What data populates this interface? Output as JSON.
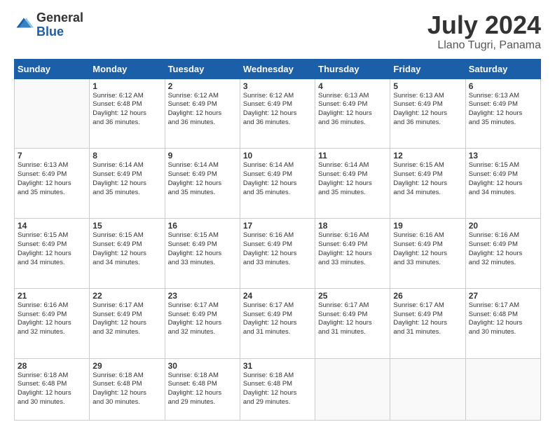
{
  "logo": {
    "general": "General",
    "blue": "Blue"
  },
  "title": "July 2024",
  "subtitle": "Llano Tugri, Panama",
  "days_header": [
    "Sunday",
    "Monday",
    "Tuesday",
    "Wednesday",
    "Thursday",
    "Friday",
    "Saturday"
  ],
  "weeks": [
    [
      {
        "date": "",
        "info": ""
      },
      {
        "date": "1",
        "info": "Sunrise: 6:12 AM\nSunset: 6:48 PM\nDaylight: 12 hours\nand 36 minutes."
      },
      {
        "date": "2",
        "info": "Sunrise: 6:12 AM\nSunset: 6:49 PM\nDaylight: 12 hours\nand 36 minutes."
      },
      {
        "date": "3",
        "info": "Sunrise: 6:12 AM\nSunset: 6:49 PM\nDaylight: 12 hours\nand 36 minutes."
      },
      {
        "date": "4",
        "info": "Sunrise: 6:13 AM\nSunset: 6:49 PM\nDaylight: 12 hours\nand 36 minutes."
      },
      {
        "date": "5",
        "info": "Sunrise: 6:13 AM\nSunset: 6:49 PM\nDaylight: 12 hours\nand 36 minutes."
      },
      {
        "date": "6",
        "info": "Sunrise: 6:13 AM\nSunset: 6:49 PM\nDaylight: 12 hours\nand 35 minutes."
      }
    ],
    [
      {
        "date": "7",
        "info": "Sunrise: 6:13 AM\nSunset: 6:49 PM\nDaylight: 12 hours\nand 35 minutes."
      },
      {
        "date": "8",
        "info": "Sunrise: 6:14 AM\nSunset: 6:49 PM\nDaylight: 12 hours\nand 35 minutes."
      },
      {
        "date": "9",
        "info": "Sunrise: 6:14 AM\nSunset: 6:49 PM\nDaylight: 12 hours\nand 35 minutes."
      },
      {
        "date": "10",
        "info": "Sunrise: 6:14 AM\nSunset: 6:49 PM\nDaylight: 12 hours\nand 35 minutes."
      },
      {
        "date": "11",
        "info": "Sunrise: 6:14 AM\nSunset: 6:49 PM\nDaylight: 12 hours\nand 35 minutes."
      },
      {
        "date": "12",
        "info": "Sunrise: 6:15 AM\nSunset: 6:49 PM\nDaylight: 12 hours\nand 34 minutes."
      },
      {
        "date": "13",
        "info": "Sunrise: 6:15 AM\nSunset: 6:49 PM\nDaylight: 12 hours\nand 34 minutes."
      }
    ],
    [
      {
        "date": "14",
        "info": "Sunrise: 6:15 AM\nSunset: 6:49 PM\nDaylight: 12 hours\nand 34 minutes."
      },
      {
        "date": "15",
        "info": "Sunrise: 6:15 AM\nSunset: 6:49 PM\nDaylight: 12 hours\nand 34 minutes."
      },
      {
        "date": "16",
        "info": "Sunrise: 6:15 AM\nSunset: 6:49 PM\nDaylight: 12 hours\nand 33 minutes."
      },
      {
        "date": "17",
        "info": "Sunrise: 6:16 AM\nSunset: 6:49 PM\nDaylight: 12 hours\nand 33 minutes."
      },
      {
        "date": "18",
        "info": "Sunrise: 6:16 AM\nSunset: 6:49 PM\nDaylight: 12 hours\nand 33 minutes."
      },
      {
        "date": "19",
        "info": "Sunrise: 6:16 AM\nSunset: 6:49 PM\nDaylight: 12 hours\nand 33 minutes."
      },
      {
        "date": "20",
        "info": "Sunrise: 6:16 AM\nSunset: 6:49 PM\nDaylight: 12 hours\nand 32 minutes."
      }
    ],
    [
      {
        "date": "21",
        "info": "Sunrise: 6:16 AM\nSunset: 6:49 PM\nDaylight: 12 hours\nand 32 minutes."
      },
      {
        "date": "22",
        "info": "Sunrise: 6:17 AM\nSunset: 6:49 PM\nDaylight: 12 hours\nand 32 minutes."
      },
      {
        "date": "23",
        "info": "Sunrise: 6:17 AM\nSunset: 6:49 PM\nDaylight: 12 hours\nand 32 minutes."
      },
      {
        "date": "24",
        "info": "Sunrise: 6:17 AM\nSunset: 6:49 PM\nDaylight: 12 hours\nand 31 minutes."
      },
      {
        "date": "25",
        "info": "Sunrise: 6:17 AM\nSunset: 6:49 PM\nDaylight: 12 hours\nand 31 minutes."
      },
      {
        "date": "26",
        "info": "Sunrise: 6:17 AM\nSunset: 6:49 PM\nDaylight: 12 hours\nand 31 minutes."
      },
      {
        "date": "27",
        "info": "Sunrise: 6:17 AM\nSunset: 6:48 PM\nDaylight: 12 hours\nand 30 minutes."
      }
    ],
    [
      {
        "date": "28",
        "info": "Sunrise: 6:18 AM\nSunset: 6:48 PM\nDaylight: 12 hours\nand 30 minutes."
      },
      {
        "date": "29",
        "info": "Sunrise: 6:18 AM\nSunset: 6:48 PM\nDaylight: 12 hours\nand 30 minutes."
      },
      {
        "date": "30",
        "info": "Sunrise: 6:18 AM\nSunset: 6:48 PM\nDaylight: 12 hours\nand 29 minutes."
      },
      {
        "date": "31",
        "info": "Sunrise: 6:18 AM\nSunset: 6:48 PM\nDaylight: 12 hours\nand 29 minutes."
      },
      {
        "date": "",
        "info": ""
      },
      {
        "date": "",
        "info": ""
      },
      {
        "date": "",
        "info": ""
      }
    ]
  ]
}
